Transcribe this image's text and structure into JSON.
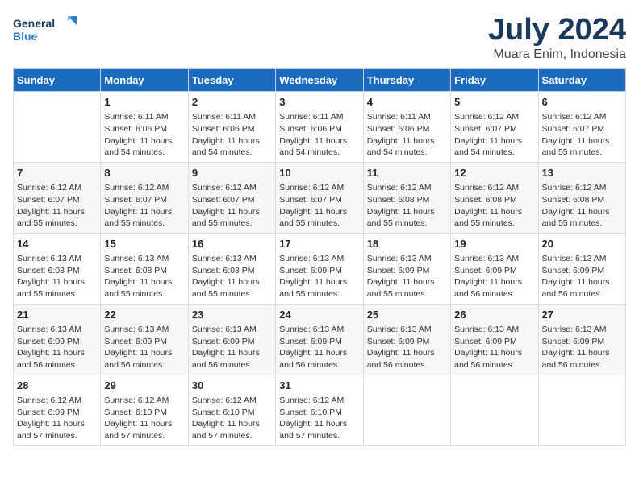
{
  "logo": {
    "line1": "General",
    "line2": "Blue"
  },
  "title": "July 2024",
  "subtitle": "Muara Enim, Indonesia",
  "days_header": [
    "Sunday",
    "Monday",
    "Tuesday",
    "Wednesday",
    "Thursday",
    "Friday",
    "Saturday"
  ],
  "weeks": [
    [
      {
        "day": "",
        "info": ""
      },
      {
        "day": "1",
        "info": "Sunrise: 6:11 AM\nSunset: 6:06 PM\nDaylight: 11 hours\nand 54 minutes."
      },
      {
        "day": "2",
        "info": "Sunrise: 6:11 AM\nSunset: 6:06 PM\nDaylight: 11 hours\nand 54 minutes."
      },
      {
        "day": "3",
        "info": "Sunrise: 6:11 AM\nSunset: 6:06 PM\nDaylight: 11 hours\nand 54 minutes."
      },
      {
        "day": "4",
        "info": "Sunrise: 6:11 AM\nSunset: 6:06 PM\nDaylight: 11 hours\nand 54 minutes."
      },
      {
        "day": "5",
        "info": "Sunrise: 6:12 AM\nSunset: 6:07 PM\nDaylight: 11 hours\nand 54 minutes."
      },
      {
        "day": "6",
        "info": "Sunrise: 6:12 AM\nSunset: 6:07 PM\nDaylight: 11 hours\nand 55 minutes."
      }
    ],
    [
      {
        "day": "7",
        "info": "Sunrise: 6:12 AM\nSunset: 6:07 PM\nDaylight: 11 hours\nand 55 minutes."
      },
      {
        "day": "8",
        "info": "Sunrise: 6:12 AM\nSunset: 6:07 PM\nDaylight: 11 hours\nand 55 minutes."
      },
      {
        "day": "9",
        "info": "Sunrise: 6:12 AM\nSunset: 6:07 PM\nDaylight: 11 hours\nand 55 minutes."
      },
      {
        "day": "10",
        "info": "Sunrise: 6:12 AM\nSunset: 6:07 PM\nDaylight: 11 hours\nand 55 minutes."
      },
      {
        "day": "11",
        "info": "Sunrise: 6:12 AM\nSunset: 6:08 PM\nDaylight: 11 hours\nand 55 minutes."
      },
      {
        "day": "12",
        "info": "Sunrise: 6:12 AM\nSunset: 6:08 PM\nDaylight: 11 hours\nand 55 minutes."
      },
      {
        "day": "13",
        "info": "Sunrise: 6:12 AM\nSunset: 6:08 PM\nDaylight: 11 hours\nand 55 minutes."
      }
    ],
    [
      {
        "day": "14",
        "info": "Sunrise: 6:13 AM\nSunset: 6:08 PM\nDaylight: 11 hours\nand 55 minutes."
      },
      {
        "day": "15",
        "info": "Sunrise: 6:13 AM\nSunset: 6:08 PM\nDaylight: 11 hours\nand 55 minutes."
      },
      {
        "day": "16",
        "info": "Sunrise: 6:13 AM\nSunset: 6:08 PM\nDaylight: 11 hours\nand 55 minutes."
      },
      {
        "day": "17",
        "info": "Sunrise: 6:13 AM\nSunset: 6:09 PM\nDaylight: 11 hours\nand 55 minutes."
      },
      {
        "day": "18",
        "info": "Sunrise: 6:13 AM\nSunset: 6:09 PM\nDaylight: 11 hours\nand 55 minutes."
      },
      {
        "day": "19",
        "info": "Sunrise: 6:13 AM\nSunset: 6:09 PM\nDaylight: 11 hours\nand 56 minutes."
      },
      {
        "day": "20",
        "info": "Sunrise: 6:13 AM\nSunset: 6:09 PM\nDaylight: 11 hours\nand 56 minutes."
      }
    ],
    [
      {
        "day": "21",
        "info": "Sunrise: 6:13 AM\nSunset: 6:09 PM\nDaylight: 11 hours\nand 56 minutes."
      },
      {
        "day": "22",
        "info": "Sunrise: 6:13 AM\nSunset: 6:09 PM\nDaylight: 11 hours\nand 56 minutes."
      },
      {
        "day": "23",
        "info": "Sunrise: 6:13 AM\nSunset: 6:09 PM\nDaylight: 11 hours\nand 56 minutes."
      },
      {
        "day": "24",
        "info": "Sunrise: 6:13 AM\nSunset: 6:09 PM\nDaylight: 11 hours\nand 56 minutes."
      },
      {
        "day": "25",
        "info": "Sunrise: 6:13 AM\nSunset: 6:09 PM\nDaylight: 11 hours\nand 56 minutes."
      },
      {
        "day": "26",
        "info": "Sunrise: 6:13 AM\nSunset: 6:09 PM\nDaylight: 11 hours\nand 56 minutes."
      },
      {
        "day": "27",
        "info": "Sunrise: 6:13 AM\nSunset: 6:09 PM\nDaylight: 11 hours\nand 56 minutes."
      }
    ],
    [
      {
        "day": "28",
        "info": "Sunrise: 6:12 AM\nSunset: 6:09 PM\nDaylight: 11 hours\nand 57 minutes."
      },
      {
        "day": "29",
        "info": "Sunrise: 6:12 AM\nSunset: 6:10 PM\nDaylight: 11 hours\nand 57 minutes."
      },
      {
        "day": "30",
        "info": "Sunrise: 6:12 AM\nSunset: 6:10 PM\nDaylight: 11 hours\nand 57 minutes."
      },
      {
        "day": "31",
        "info": "Sunrise: 6:12 AM\nSunset: 6:10 PM\nDaylight: 11 hours\nand 57 minutes."
      },
      {
        "day": "",
        "info": ""
      },
      {
        "day": "",
        "info": ""
      },
      {
        "day": "",
        "info": ""
      }
    ]
  ]
}
